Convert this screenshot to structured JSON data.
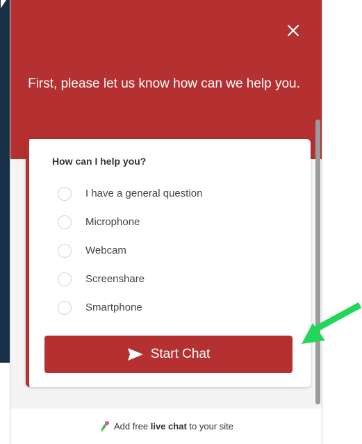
{
  "widget": {
    "heading": "First, please let us know how can we help you.",
    "form": {
      "question": "How can I help you?",
      "options": [
        {
          "label": "I have a general question"
        },
        {
          "label": "Microphone"
        },
        {
          "label": "Webcam"
        },
        {
          "label": "Screenshare"
        },
        {
          "label": "Smartphone"
        }
      ],
      "submit_label": "Start Chat"
    },
    "footer": {
      "prefix": "Add free",
      "bold": "live chat",
      "suffix": "to your site"
    }
  },
  "colors": {
    "brand": "#b53030",
    "annotation_arrow": "#22d65b"
  },
  "icons": [
    "close-icon",
    "send-icon",
    "leaf-logo-icon",
    "green-arrow-annotation"
  ]
}
